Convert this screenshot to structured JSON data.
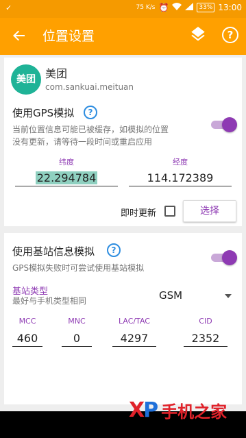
{
  "status_bar": {
    "left_indicator": "✓",
    "net_speed": "75 K/s",
    "battery": "33%",
    "time": "13:00"
  },
  "app_bar": {
    "title": "位置设置",
    "back_icon": "arrow-left-icon",
    "layers_icon": "layers-icon",
    "help_icon": "help-circle-icon",
    "help_glyph": "?"
  },
  "app_info": {
    "icon_text": "美团",
    "name": "美团",
    "package": "com.sankuai.meituan"
  },
  "gps_section": {
    "title": "使用GPS模拟",
    "help_glyph": "?",
    "description_line1": "当前位置信息可能已被缓存，如模拟的位置",
    "description_line2": "没有更新，请等待一段时间或重启应用",
    "enabled": true,
    "latitude_label": "纬度",
    "latitude_value": "22.294784",
    "longitude_label": "经度",
    "longitude_value": "114.172389",
    "realtime_label": "即时更新",
    "realtime_checked": false,
    "select_button": "选择"
  },
  "cell_section": {
    "title": "使用基站信息模拟",
    "help_glyph": "?",
    "description": "GPS模拟失败时可尝试使用基站模拟",
    "enabled": true,
    "type_label": "基站类型",
    "type_hint": "最好与手机类型相同",
    "type_value": "GSM",
    "fields": [
      {
        "label": "MCC",
        "value": "460"
      },
      {
        "label": "MNC",
        "value": "0"
      },
      {
        "label": "LAC/TAC",
        "value": "4297"
      },
      {
        "label": "CID",
        "value": "2352"
      }
    ]
  },
  "watermark": {
    "logo": "XP",
    "text": "手机之家"
  },
  "colors": {
    "status_bar": "#f59a00",
    "app_bar": "#ffa000",
    "accent_purple": "#8e3ab3",
    "help_blue": "#2d8de0",
    "app_icon": "#1fb397"
  }
}
